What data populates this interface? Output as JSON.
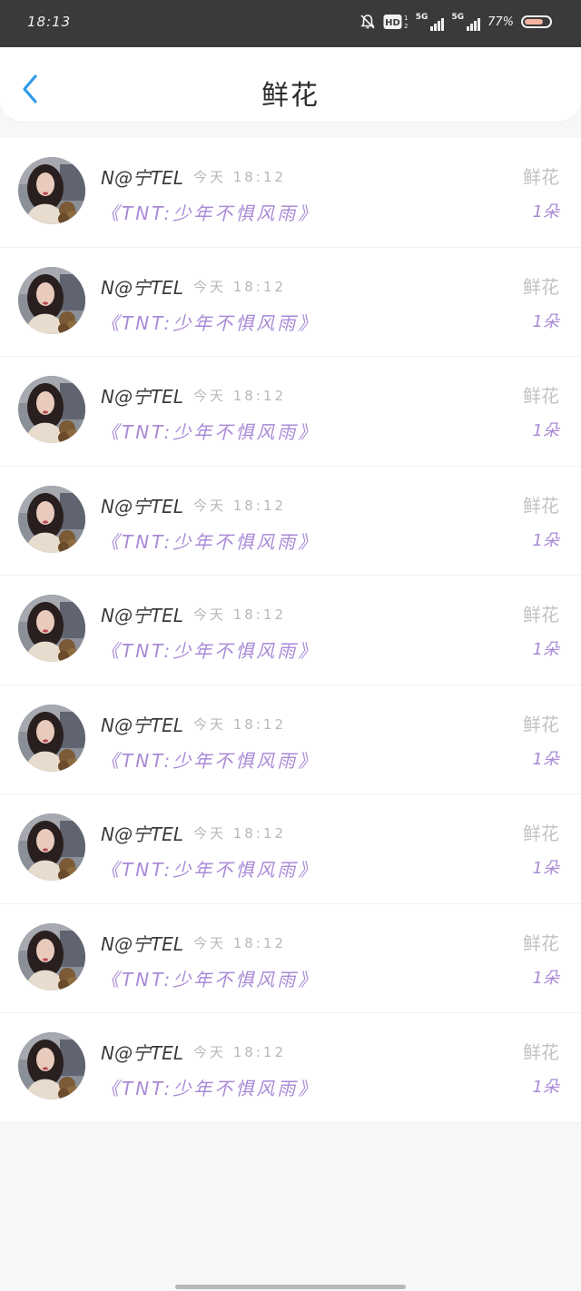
{
  "status_bar": {
    "time": "18:13",
    "battery_percent": "77%",
    "battery_level": 0.77,
    "network_1": "5G",
    "network_2": "5G",
    "hd_label": "HD",
    "icons": [
      "bell-off-icon",
      "hd-icon",
      "signal-icon",
      "signal-icon",
      "battery-icon"
    ]
  },
  "header": {
    "title": "鲜花",
    "back_icon": "chevron-left-icon"
  },
  "colors": {
    "accent_purple": "#a98ad6",
    "back_blue": "#2f9bea",
    "status_bg": "#3a3a3a"
  },
  "items": [
    {
      "sender": "N@宁TEL",
      "time": "今天 18:12",
      "song": "《TNT:少年不惧风雨》",
      "gift": "鲜花",
      "count": "1朵"
    },
    {
      "sender": "N@宁TEL",
      "time": "今天 18:12",
      "song": "《TNT:少年不惧风雨》",
      "gift": "鲜花",
      "count": "1朵"
    },
    {
      "sender": "N@宁TEL",
      "time": "今天 18:12",
      "song": "《TNT:少年不惧风雨》",
      "gift": "鲜花",
      "count": "1朵"
    },
    {
      "sender": "N@宁TEL",
      "time": "今天 18:12",
      "song": "《TNT:少年不惧风雨》",
      "gift": "鲜花",
      "count": "1朵"
    },
    {
      "sender": "N@宁TEL",
      "time": "今天 18:12",
      "song": "《TNT:少年不惧风雨》",
      "gift": "鲜花",
      "count": "1朵"
    },
    {
      "sender": "N@宁TEL",
      "time": "今天 18:12",
      "song": "《TNT:少年不惧风雨》",
      "gift": "鲜花",
      "count": "1朵"
    },
    {
      "sender": "N@宁TEL",
      "time": "今天 18:12",
      "song": "《TNT:少年不惧风雨》",
      "gift": "鲜花",
      "count": "1朵"
    },
    {
      "sender": "N@宁TEL",
      "time": "今天 18:12",
      "song": "《TNT:少年不惧风雨》",
      "gift": "鲜花",
      "count": "1朵"
    },
    {
      "sender": "N@宁TEL",
      "time": "今天 18:12",
      "song": "《TNT:少年不惧风雨》",
      "gift": "鲜花",
      "count": "1朵"
    }
  ]
}
